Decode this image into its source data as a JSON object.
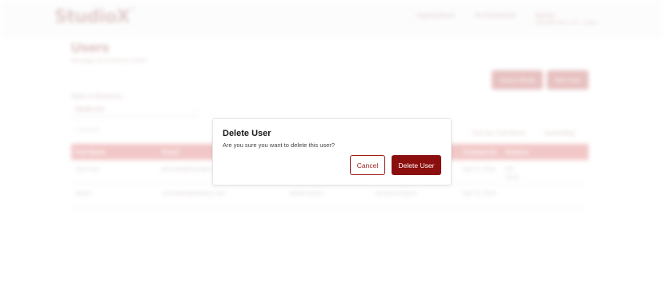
{
  "app": {
    "logo": "StudioX",
    "logo_tm": "™",
    "nav": [
      "Applications",
      "AI Assistants",
      "Admin"
    ],
    "nav_sub": "admin@studiox.com · Logout"
  },
  "page": {
    "title": "Users",
    "subtitle": "Manage all business users",
    "import_label": "Import (Bulk)",
    "add_label": "Add User",
    "business_label": "Select a Business",
    "business_value": "Studio Ark",
    "search_placeholder": "Search",
    "sort_by": "Sort by: Full Name",
    "sort_dir": "Ascending",
    "columns": [
      "Full Name",
      "Email",
      "",
      "",
      "Created On",
      "Actions"
    ],
    "rows": [
      {
        "name": "John Doe",
        "email": "john.doe@example.com",
        "c3": "",
        "c4": "",
        "created": "Mar 11, 2024",
        "actions": [
          "Edit",
          "Delete"
        ]
      },
      {
        "name": "Admin",
        "email": "user.admin@studiox.com",
        "c3": "Studio Admin",
        "c4": "Business Admin",
        "created": "Mar 10, 2024",
        "actions": []
      }
    ]
  },
  "modal": {
    "title": "Delete User",
    "message": "Are you sure you want to delete this user?",
    "cancel_label": "Cancel",
    "delete_label": "Delete User"
  },
  "colors": {
    "accent": "#8c0f0f",
    "accent_outline": "#9c1c1c",
    "table_header": "#e79a9a"
  }
}
